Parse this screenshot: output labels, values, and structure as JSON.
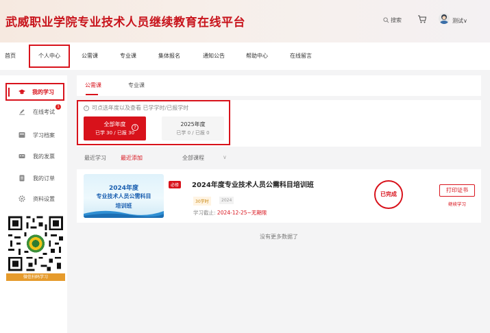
{
  "header": {
    "site_title": "武威职业学院专业技术人员继续教育在线平台",
    "search_label": "搜索",
    "user_name": "测试∨"
  },
  "nav": {
    "items": [
      {
        "label": "首页"
      },
      {
        "label": "个人中心",
        "active": true
      },
      {
        "label": "公需课"
      },
      {
        "label": "专业课"
      },
      {
        "label": "集体报名"
      },
      {
        "label": "通知公告"
      },
      {
        "label": "帮助中心"
      },
      {
        "label": "在线留言"
      }
    ]
  },
  "sidebar": {
    "items": [
      {
        "label": "我的学习",
        "icon": "graduation-cap-icon",
        "active": true
      },
      {
        "label": "在线考试",
        "icon": "pen-icon",
        "badge": "1"
      },
      {
        "label": "学习档案",
        "icon": "archive-icon"
      },
      {
        "label": "我的发票",
        "icon": "invoice-icon"
      },
      {
        "label": "我的订单",
        "icon": "order-icon"
      },
      {
        "label": "资料设置",
        "icon": "gear-icon"
      }
    ],
    "qr_label": "微信扫码学习"
  },
  "main": {
    "tabs": [
      {
        "label": "公需课",
        "active": true
      },
      {
        "label": "专业课"
      }
    ],
    "hint": "可点选年度以及查看 已学学时/已报学时",
    "years": [
      {
        "title": "全部年度",
        "sub": "已学 30 / 已报 30",
        "selected": true,
        "help": "?"
      },
      {
        "title": "2025年度",
        "sub": "已学 0 / 已报 0",
        "selected": false
      }
    ],
    "filters": {
      "recent_study": "最近学习",
      "recent_added": "最近添加",
      "all_courses": "全部课程",
      "chevron": "∨"
    },
    "course": {
      "thumb_line1": "2024年度",
      "thumb_line2": "专业技术人员公需科目",
      "thumb_line3": "培训班",
      "tag_required": "必修",
      "title": "2024年度专业技术人员公需科目培训班",
      "tag_hours": "30学时",
      "tag_year": "2024",
      "deadline_label": "学习截止:",
      "deadline_value": "2024-12-25~无期限",
      "status": "已完成",
      "print_label": "打印证书",
      "continue_label": "继续学习"
    },
    "no_more": "没有更多数据了"
  },
  "colors": {
    "brand": "#d8121b",
    "qr_label_bg": "#e69b2c"
  }
}
